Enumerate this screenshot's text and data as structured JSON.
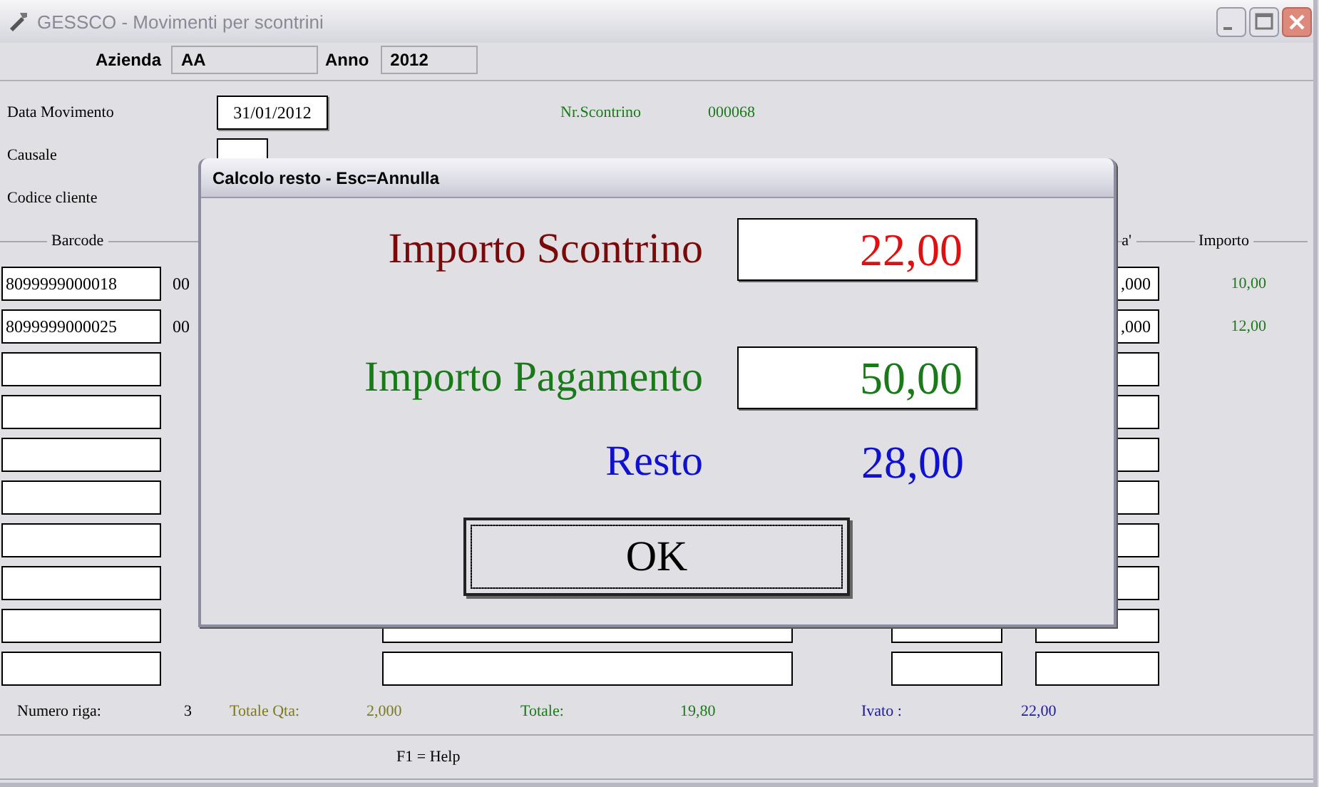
{
  "window": {
    "title": "GESSCO - Movimenti per scontrini"
  },
  "header": {
    "azienda": {
      "label": "Azienda",
      "value": "AA"
    },
    "anno": {
      "label": "Anno",
      "value": "2012"
    }
  },
  "form": {
    "data_movimento": {
      "label": "Data Movimento",
      "value": "31/01/2012"
    },
    "nr_scontrino": {
      "label": "Nr.Scontrino",
      "value": "000068"
    },
    "causale": {
      "label": "Causale"
    },
    "codice_cliente": {
      "label": "Codice cliente"
    }
  },
  "table": {
    "columns": [
      "Barcode",
      "a'",
      "Importo"
    ],
    "rows": [
      {
        "kind": "covered",
        "barcode": "8099999000018",
        "code": "00",
        "qty": ",000",
        "amount": "10,00"
      },
      {
        "kind": "covered",
        "barcode": "8099999000025",
        "code": "00",
        "qty": ",000",
        "amount": "12,00"
      },
      {
        "kind": "covered"
      },
      {
        "kind": "covered"
      },
      {
        "kind": "covered"
      },
      {
        "kind": "covered"
      },
      {
        "kind": "covered"
      },
      {
        "kind": "covered"
      },
      {
        "kind": "open"
      },
      {
        "kind": "open"
      }
    ]
  },
  "totals": {
    "numero_riga": {
      "label": "Numero riga:",
      "value": "3"
    },
    "totale_qta": {
      "label": "Totale Qta:",
      "value": "2,000"
    },
    "totale": {
      "label": "Totale:",
      "value": "19,80"
    },
    "ivato": {
      "label": "Ivato :",
      "value": "22,00"
    }
  },
  "status_bar": "F1 = Help",
  "dialog": {
    "title": "Calcolo resto - Esc=Annulla",
    "importo_scontrino": {
      "label": "Importo Scontrino",
      "value": "22,00"
    },
    "importo_pagamento": {
      "label": "Importo Pagamento",
      "value": "50,00"
    },
    "resto": {
      "label": "Resto",
      "value": "28,00"
    },
    "ok_button": "OK"
  }
}
